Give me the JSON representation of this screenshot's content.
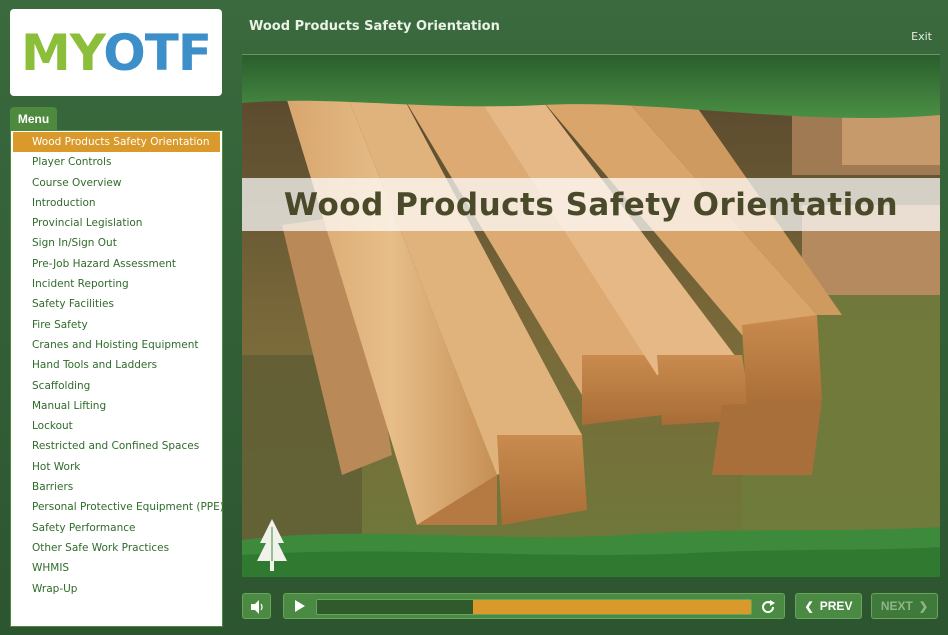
{
  "logo": {
    "text_m": "M",
    "text_y": "Y",
    "text_otf": "OTF",
    "colors": {
      "green": "#8bbf3a",
      "blue": "#3d8fc9"
    }
  },
  "menu": {
    "tab_label": "Menu",
    "items": [
      {
        "label": "Wood Products Safety Orientation",
        "active": true
      },
      {
        "label": "Player Controls"
      },
      {
        "label": "Course Overview"
      },
      {
        "label": "Introduction"
      },
      {
        "label": "Provincial Legislation"
      },
      {
        "label": "Sign In/Sign Out"
      },
      {
        "label": "Pre-Job Hazard Assessment"
      },
      {
        "label": "Incident Reporting"
      },
      {
        "label": "Safety Facilities"
      },
      {
        "label": "Fire Safety"
      },
      {
        "label": "Cranes and Hoisting Equipment"
      },
      {
        "label": "Hand Tools and Ladders"
      },
      {
        "label": "Scaffolding"
      },
      {
        "label": "Manual Lifting"
      },
      {
        "label": "Lockout"
      },
      {
        "label": "Restricted and Confined Spaces"
      },
      {
        "label": "Hot Work"
      },
      {
        "label": "Barriers"
      },
      {
        "label": "Personal Protective Equipment (PPE)"
      },
      {
        "label": "Safety Performance"
      },
      {
        "label": "Other Safe Work Practices"
      },
      {
        "label": "WHMIS"
      },
      {
        "label": "Wrap-Up"
      }
    ]
  },
  "header": {
    "course_title": "Wood Products Safety Orientation",
    "exit_label": "Exit"
  },
  "slide": {
    "title": "Wood Products Safety Orientation",
    "image_subject": "stacked-lumber-beams",
    "brand_icon": "tree-icon"
  },
  "player": {
    "volume_icon": "speaker-icon",
    "play_icon": "play-icon",
    "replay_icon": "replay-icon",
    "progress_fraction": 0.64,
    "prev_label": "PREV",
    "next_label": "NEXT",
    "accent": "#d99a2b",
    "theme_green": "#4a8a42"
  }
}
